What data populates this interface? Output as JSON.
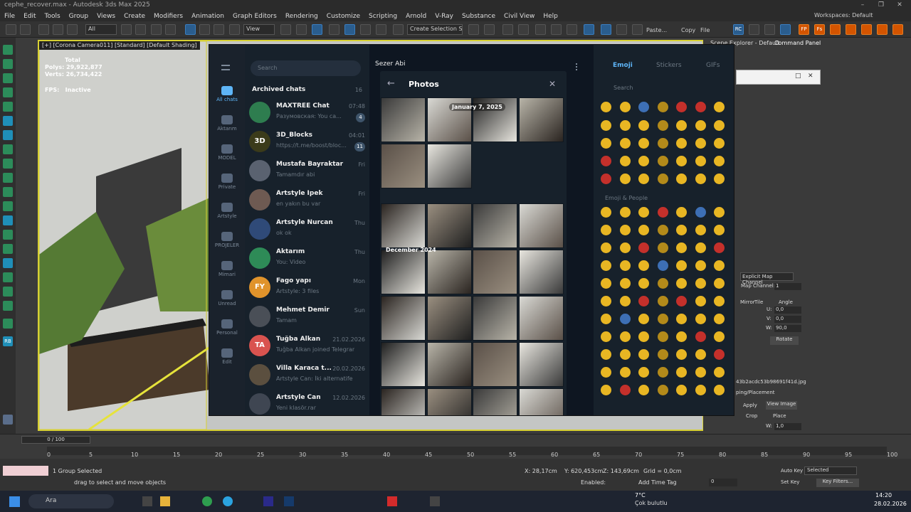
{
  "app": {
    "title": "cephe_recover.max - Autodesk 3ds Max 2025",
    "workspaces_label": "Workspaces:",
    "workspace": "Default"
  },
  "menus": [
    "File",
    "Edit",
    "Tools",
    "Group",
    "Views",
    "Create",
    "Modifiers",
    "Animation",
    "Graph Editors",
    "Rendering",
    "Customize",
    "Scripting",
    "Arnold",
    "V-Ray",
    "Substance",
    "Civil View",
    "Help"
  ],
  "toolbar": {
    "selection_filter": "All",
    "view": "View",
    "selection_set": "Create Selection Se",
    "paste": "Paste...",
    "copy": "Copy",
    "file": "File",
    "rc": "RC",
    "fp": "FP",
    "fs": "Fs"
  },
  "viewport": {
    "label": "[+] [Corona Camera011] [Standard] [Default Shading]",
    "total": "Total",
    "polys_label": "Polys:",
    "polys": "29,922,877",
    "verts_label": "Verts:",
    "verts": "26,734,422",
    "fps_label": "FPS:",
    "fps": "Inactive"
  },
  "right_panel": {
    "scene_explorer": "Scene Explorer - Default",
    "command_panel": "Command Panel",
    "map_channel_type": "Explicit Map Channel",
    "map_channel_label": "Map Channel:",
    "map_channel": "1",
    "mirror": "Mirror",
    "tile": "Tile",
    "angle": "Angle",
    "u_label": "U:",
    "u": "0,0",
    "v_label": "V:",
    "v": "0,0",
    "w_label": "W:",
    "w": "90,0",
    "rotate": "Rotate",
    "bitmap_name": "43b2acdc53b98691f41d.jpg",
    "cropping": "ping/Placement",
    "apply": "Apply",
    "view_image": "View Image",
    "crop": "Crop",
    "place": "Place",
    "w2": "1,0",
    "w2_label": "W:"
  },
  "timeline": {
    "frame": "0 / 100",
    "ticks": [
      "0",
      "5",
      "10",
      "15",
      "20",
      "25",
      "30",
      "35",
      "40",
      "45",
      "50",
      "55",
      "60",
      "65",
      "70",
      "75",
      "80",
      "85",
      "90",
      "95",
      "100"
    ]
  },
  "status": {
    "selected": "1 Group Selected",
    "hint": "drag to select and move objects",
    "x_label": "X:",
    "x": "28,17cm",
    "y_label": "Y:",
    "y": "620,453cm",
    "z_label": "Z:",
    "z": "143,69cm",
    "grid": "Grid = 0,0cm",
    "enabled": "Enabled:",
    "add_time_tag": "Add Time Tag",
    "autokey": "Auto Key",
    "setkey": "Set Key",
    "selected_set": "Selected",
    "key_filters": "Key Filters...",
    "frame_value": "0"
  },
  "taskbar": {
    "search": "Ara",
    "weather_temp": "7°C",
    "weather_desc": "Çok bulutlu",
    "time": "14:20",
    "date": "28.02.2026"
  },
  "telegram": {
    "search_placeholder": "Search",
    "header_name": "Sezer Abi",
    "rail": [
      {
        "label": "All chats",
        "badge": "19"
      },
      {
        "label": "Aktarım",
        "badge": ""
      },
      {
        "label": "MODEL",
        "badge": "4"
      },
      {
        "label": "Private",
        "badge": ""
      },
      {
        "label": "Artstyle",
        "badge": ""
      },
      {
        "label": "PROJELER",
        "badge": ""
      },
      {
        "label": "Mimari",
        "badge": "5"
      },
      {
        "label": "Unread",
        "badge": "19"
      },
      {
        "label": "Personal",
        "badge": "1"
      },
      {
        "label": "Edit",
        "badge": ""
      }
    ],
    "archived": {
      "label": "Archived chats",
      "count": "16"
    },
    "chats": [
      {
        "name": "MAXTREE Chat",
        "msg": "Разумовская: You ca...",
        "time": "07:48",
        "badge": "4",
        "initials": "",
        "color": "#2e7d4f"
      },
      {
        "name": "3D_Blocks",
        "msg": "https://t.me/boost/bloc...",
        "time": "04:01",
        "badge": "11",
        "initials": "3D",
        "color": "#3b3b1a"
      },
      {
        "name": "Mustafa Bayraktar",
        "msg": "Tamamdır abi",
        "time": "Fri",
        "badge": "",
        "initials": "",
        "color": "#5a6270"
      },
      {
        "name": "Artstyle İpek",
        "msg": "en yakın bu var",
        "time": "Fri",
        "badge": "",
        "initials": "",
        "color": "#6e5a52"
      },
      {
        "name": "Artstyle Nurcan",
        "msg": "ok ok",
        "time": "Thu",
        "badge": "",
        "initials": "",
        "color": "#2f4a78"
      },
      {
        "name": "Aktarım",
        "msg": "You: Video",
        "time": "Thu",
        "badge": "",
        "initials": "",
        "color": "#2e8b57"
      },
      {
        "name": "Fago yapı",
        "msg": "Artstyle: 3 files",
        "time": "Mon",
        "badge": "",
        "initials": "FY",
        "color": "#e0932b"
      },
      {
        "name": "Mehmet Demir",
        "msg": "Tamam",
        "time": "Sun",
        "badge": "",
        "initials": "",
        "color": "#4a4f57"
      },
      {
        "name": "Tuğba Alkan",
        "msg": "Tuğba Alkan joined Telegram",
        "time": "21.02.2026",
        "badge": "",
        "initials": "TA",
        "color": "#d9534f"
      },
      {
        "name": "Villa Karaca t...",
        "msg": "Artstyle Can: İki alternatife de...",
        "time": "20.02.2026",
        "badge": "",
        "initials": "",
        "color": "#5b4f3f"
      },
      {
        "name": "Artstyle Can",
        "msg": "Yeni klasör.rar",
        "time": "12.02.2026",
        "badge": "",
        "initials": "",
        "color": "#3f4652"
      }
    ],
    "photos": {
      "title": "Photos",
      "section1": "January 7, 2025",
      "section2": "December 2024"
    },
    "emoji": {
      "tab1": "Emoji",
      "tab2": "Stickers",
      "tab3": "GIFs",
      "search_placeholder": "Search",
      "category": "Emoji & People"
    }
  },
  "colors": {
    "viewport_border": "#d7d033",
    "telegram_bg": "#17212b",
    "accent": "#5eb5f7"
  }
}
